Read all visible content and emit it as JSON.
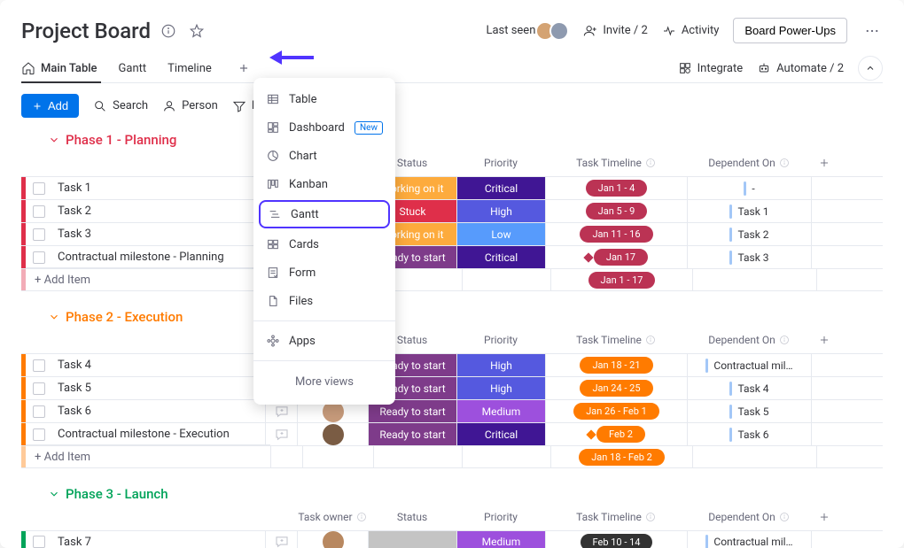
{
  "header": {
    "title": "Project Board",
    "last_seen": "Last seen",
    "invite": "Invite / 2",
    "activity": "Activity",
    "powerups": "Board Power-Ups"
  },
  "tabs": {
    "main": "Main Table",
    "gantt": "Gantt",
    "timeline": "Timeline",
    "integrate": "Integrate",
    "automate": "Automate / 2"
  },
  "toolbar": {
    "add": "Add",
    "search": "Search",
    "person": "Person",
    "filter": "Filter"
  },
  "menu": {
    "table": "Table",
    "dashboard": "Dashboard",
    "new_tag": "New",
    "chart": "Chart",
    "kanban": "Kanban",
    "gantt": "Gantt",
    "cards": "Cards",
    "form": "Form",
    "files": "Files",
    "apps": "Apps",
    "more": "More views"
  },
  "columns": {
    "owner": "Task owner",
    "status": "Status",
    "priority": "Priority",
    "timeline": "Task Timeline",
    "dependent": "Dependent On"
  },
  "add_item": "+ Add Item",
  "groups": [
    {
      "id": "phase1",
      "title": "Phase 1 - Planning",
      "color": "#df2f4a",
      "rows": [
        {
          "name": "Task 1",
          "status": "Working on it",
          "status_bg": "#fdab3d",
          "priority": "Critical",
          "priority_bg": "#401694",
          "timeline": "Jan 1 - 4",
          "timeline_bg": "#bb3354",
          "dep": "-",
          "dep_bar": "#a3c7f7"
        },
        {
          "name": "Task 2",
          "status": "Stuck",
          "status_bg": "#df2f4a",
          "priority": "High",
          "priority_bg": "#5559df",
          "timeline": "Jan 5 - 9",
          "timeline_bg": "#bb3354",
          "dep": "Task 1",
          "dep_bar": "#a3c7f7"
        },
        {
          "name": "Task 3",
          "status": "Working on it",
          "status_bg": "#fdab3d",
          "priority": "Low",
          "priority_bg": "#579bfc",
          "timeline": "Jan 11 - 16",
          "timeline_bg": "#bb3354",
          "dep": "Task 2",
          "dep_bar": "#a3c7f7"
        },
        {
          "name": "Contractual milestone - Planning",
          "status": "Ready to start",
          "status_bg": "#7e3b8a",
          "priority": "Critical",
          "priority_bg": "#401694",
          "timeline": "Jan 17",
          "timeline_bg": "#bb3354",
          "dep": "Task 3",
          "dep_bar": "#a3c7f7",
          "milestone": true
        }
      ],
      "summary_timeline": "Jan 1 - 17",
      "summary_bg": "#bb3354"
    },
    {
      "id": "phase2",
      "title": "Phase 2 - Execution",
      "color": "#ff7b00",
      "rows": [
        {
          "name": "Task 4",
          "status": "Ready to start",
          "status_bg": "#7e3b8a",
          "priority": "High",
          "priority_bg": "#5559df",
          "timeline": "Jan 18 - 21",
          "timeline_bg": "#ff7b00",
          "dep": "Contractual mil…",
          "dep_bar": "#a3c7f7",
          "owner": "#d99058"
        },
        {
          "name": "Task 5",
          "status": "Ready to start",
          "status_bg": "#7e3b8a",
          "priority": "High",
          "priority_bg": "#5559df",
          "timeline": "Jan 24 - 25",
          "timeline_bg": "#ff7b00",
          "dep": "Task 4",
          "dep_bar": "#a3c7f7",
          "owner": "#8e6a5a"
        },
        {
          "name": "Task 6",
          "status": "Ready to start",
          "status_bg": "#7e3b8a",
          "priority": "Medium",
          "priority_bg": "#9d50dd",
          "timeline": "Jan 26 - Feb 1",
          "timeline_bg": "#ff7b00",
          "dep": "Task 5",
          "dep_bar": "#a3c7f7",
          "owner": "#c79b7b"
        },
        {
          "name": "Contractual milestone - Execution",
          "status": "Ready to start",
          "status_bg": "#7e3b8a",
          "priority": "Critical",
          "priority_bg": "#401694",
          "timeline": "Feb 2",
          "timeline_bg": "#ff7b00",
          "dep": "Task 6",
          "dep_bar": "#a3c7f7",
          "owner": "#7a5c44",
          "milestone": true
        }
      ],
      "summary_timeline": "Jan 18 - Feb 2",
      "summary_bg": "#ff7b00"
    },
    {
      "id": "phase3",
      "title": "Phase 3 - Launch",
      "color": "#00a359",
      "rows": [
        {
          "name": "Task 7",
          "status": "",
          "status_bg": "#c4c4c4",
          "priority": "Medium",
          "priority_bg": "#9d50dd",
          "timeline": "Feb 10 - 14",
          "timeline_bg": "#333333",
          "dep": "Contractual mil…",
          "dep_bar": "#a3c7f7",
          "owner": "#b88860"
        }
      ]
    }
  ]
}
